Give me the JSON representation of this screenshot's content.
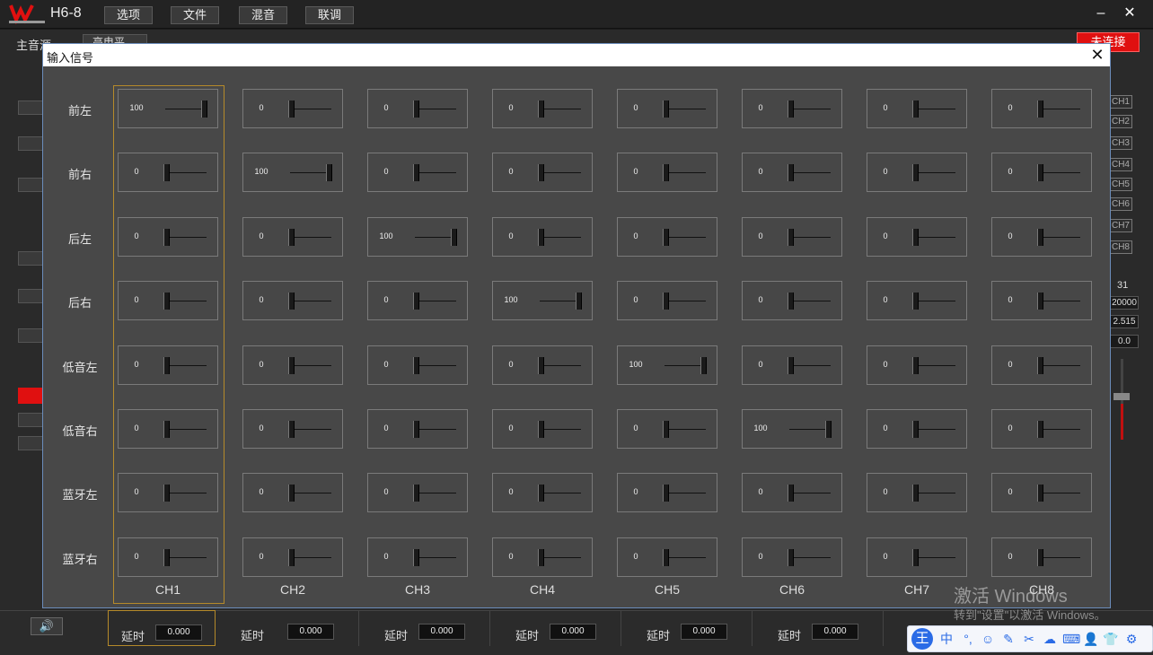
{
  "app": {
    "title": "H6-8",
    "logo_text": "W",
    "menu": [
      "选项",
      "文件",
      "混音",
      "联调"
    ],
    "minimize": "–",
    "close": "✕"
  },
  "background": {
    "master_source_label": "主音源",
    "master_source_value": "高电平",
    "connect_button": "未连接",
    "right_chips": [
      "CH1",
      "CH2",
      "CH3",
      "CH4",
      "CH5",
      "CH6",
      "CH7",
      "CH8"
    ],
    "right_values": [
      "31",
      "20000",
      "2.515",
      "0.0"
    ]
  },
  "dialog": {
    "title": "输入信号",
    "close": "✕",
    "rows": [
      "前左",
      "前右",
      "后左",
      "后右",
      "低音左",
      "低音右",
      "蓝牙左",
      "蓝牙右"
    ],
    "columns": [
      "CH1",
      "CH2",
      "CH3",
      "CH4",
      "CH5",
      "CH6",
      "CH7",
      "CH8"
    ],
    "matrix": [
      [
        100,
        0,
        0,
        0,
        0,
        0,
        0,
        0
      ],
      [
        0,
        100,
        0,
        0,
        0,
        0,
        0,
        0
      ],
      [
        0,
        0,
        100,
        0,
        0,
        0,
        0,
        0
      ],
      [
        0,
        0,
        0,
        100,
        0,
        0,
        0,
        0
      ],
      [
        0,
        0,
        0,
        0,
        100,
        0,
        0,
        0
      ],
      [
        0,
        0,
        0,
        0,
        0,
        100,
        0,
        0
      ],
      [
        0,
        0,
        0,
        0,
        0,
        0,
        0,
        0
      ],
      [
        0,
        0,
        0,
        0,
        0,
        0,
        0,
        0
      ]
    ],
    "slider_max": 100,
    "selected_column": "CH1"
  },
  "bottom": {
    "speaker_icon": "🔊",
    "delay_label": "延时",
    "delays": [
      "0.000",
      "0.000",
      "0.000",
      "0.000",
      "0.000",
      "0.000"
    ]
  },
  "watermark": {
    "title": "激活 Windows",
    "subtitle": "转到\"设置\"以激活 Windows。"
  },
  "ime": {
    "logo": "王",
    "mode": "中",
    "icons": [
      "°,",
      "☺",
      "✎",
      "✂",
      "☁",
      "⌨",
      "👤",
      "👕",
      "⚙"
    ]
  }
}
